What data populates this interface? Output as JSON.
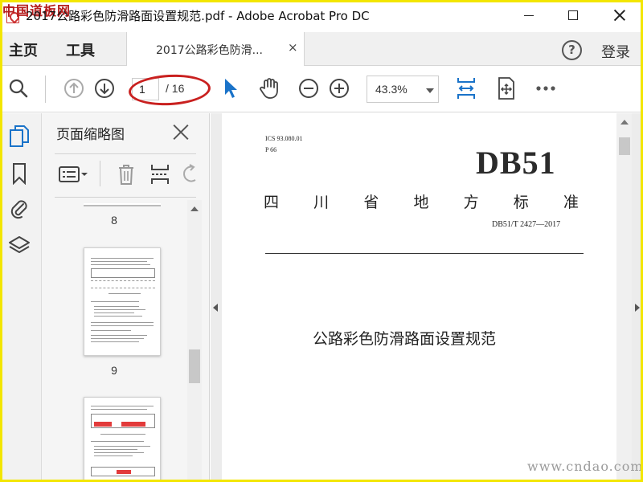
{
  "watermark": {
    "top": "中国道板网",
    "bottom": "www.cndao.com"
  },
  "window": {
    "title": "2017公路彩色防滑路面设置规范.pdf - Adobe Acrobat Pro DC"
  },
  "nav": {
    "home": "主页",
    "tools": "工具",
    "doc_tab": "2017公路彩色防滑...",
    "doc_tab_close": "×",
    "help": "?",
    "login": "登录"
  },
  "toolbar": {
    "current_page": "1",
    "total_pages": "/ 16",
    "zoom": "43.3%",
    "accent_color": "#1a73c9",
    "highlight_color": "#c9201f"
  },
  "sidebar": {
    "title": "页面缩略图",
    "icons": [
      "pages-icon",
      "bookmark-icon",
      "attachment-icon",
      "layers-icon"
    ],
    "thumbnails": [
      {
        "label": "8"
      },
      {
        "label": "9"
      },
      {
        "label": ""
      }
    ]
  },
  "document": {
    "ics": "ICS 93.080.01",
    "p_code": "P 66",
    "db": "DB51",
    "standard_chars": [
      "四",
      "川",
      "省",
      "地",
      "方",
      "标",
      "准"
    ],
    "code": "DB51/T 2427—2017",
    "title": "公路彩色防滑路面设置规范"
  }
}
